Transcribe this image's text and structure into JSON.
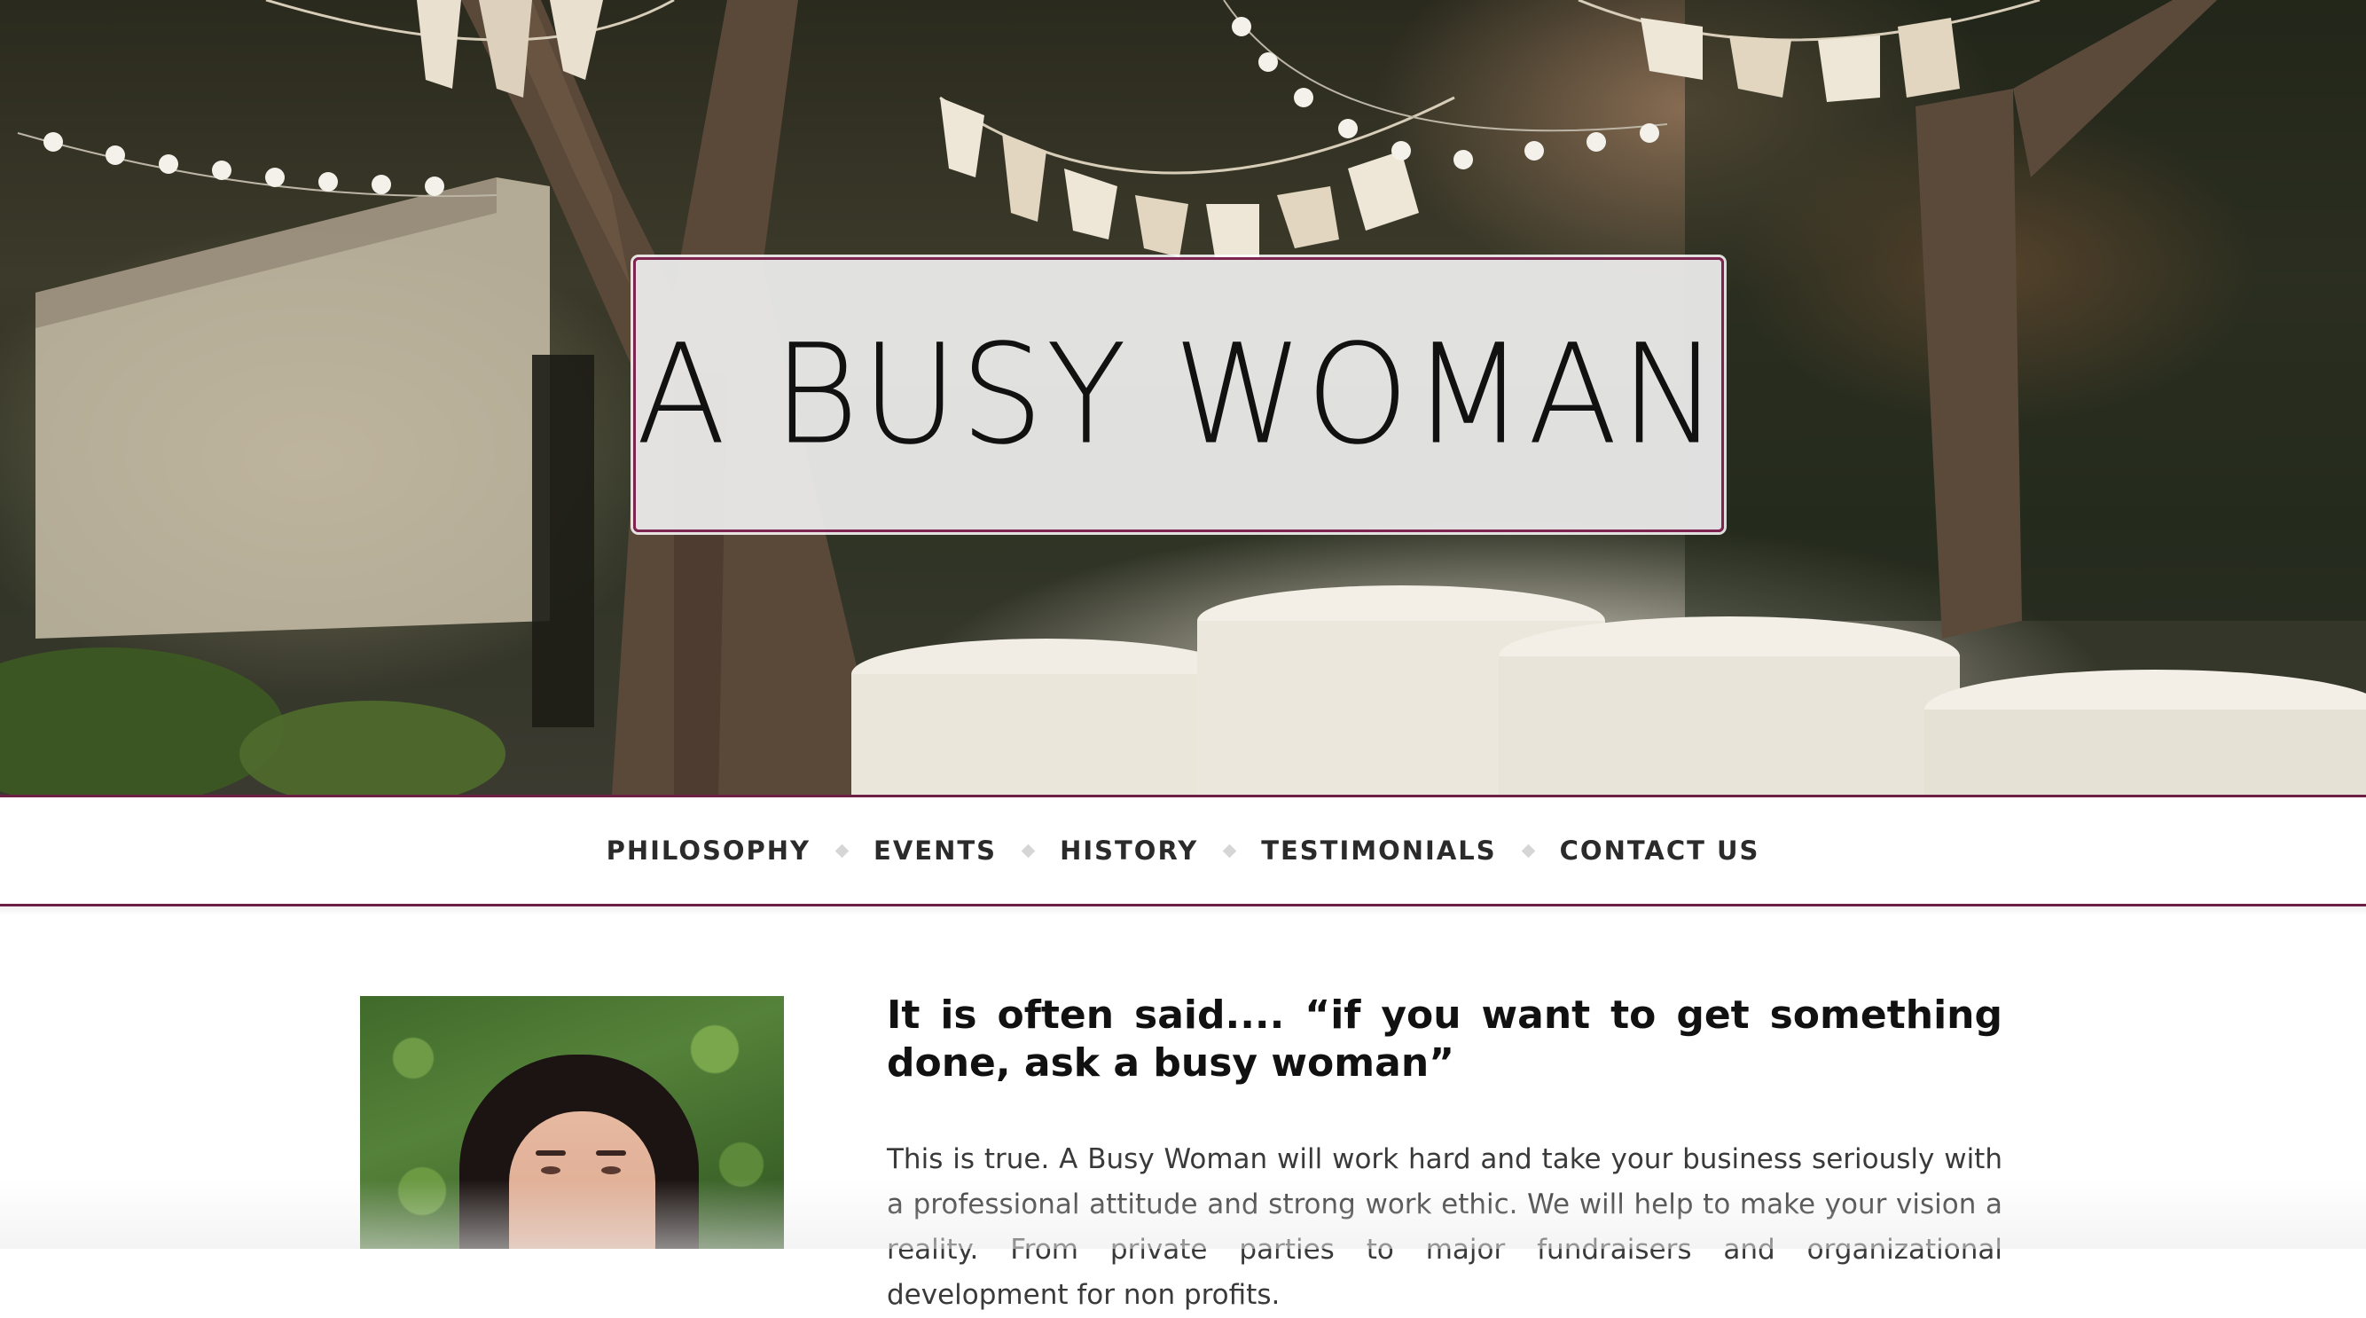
{
  "site": {
    "title": "A BUSY WOMAN"
  },
  "nav": {
    "items": [
      {
        "label": "PHILOSOPHY"
      },
      {
        "label": "EVENTS"
      },
      {
        "label": "HISTORY"
      },
      {
        "label": "TESTIMONIALS"
      },
      {
        "label": "CONTACT US"
      }
    ]
  },
  "content": {
    "headline": "It is often said.... “if you want to get something done, ask a busy woman”",
    "body": "This is true. A Busy Woman will work hard and take your business seriously with a professional attitude and strong work ethic. We will help to make your vision a reality. From private parties to major fundraisers and organizational development for non profits."
  },
  "colors": {
    "accent": "#6e1f45",
    "text_dark": "#111111",
    "text_body": "#3a3a3a",
    "title_box_bg": "#eeeeee"
  }
}
